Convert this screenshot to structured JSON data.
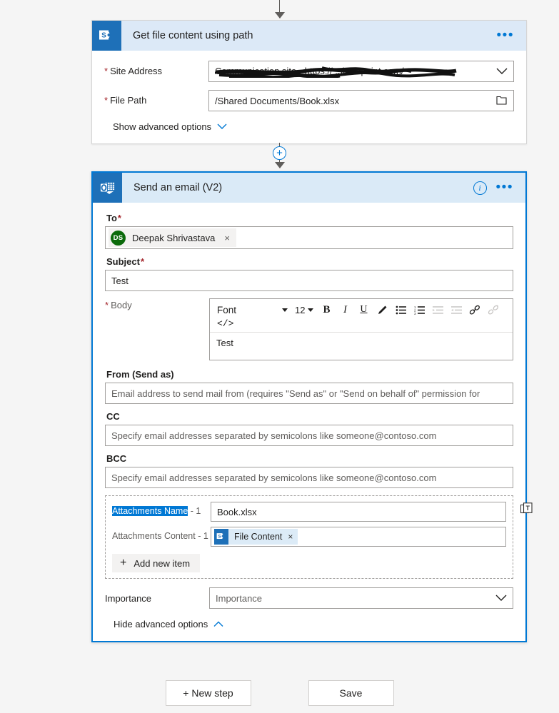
{
  "page": {
    "background": "#f5f5f5",
    "accent_blue": "#0078d4",
    "header_blue": "#dce9f7",
    "connector_brand": "#1e70b8"
  },
  "top_connector": {
    "arrow": "arrow-down-icon"
  },
  "mid_connector": {
    "plus": "+",
    "arrow": "arrow-down-icon"
  },
  "card_sharepoint": {
    "icon": "sharepoint-icon",
    "title": "Get file content using path",
    "menu": "•••",
    "fields": [
      {
        "label": "Site Address",
        "required": true,
        "required_position": "before",
        "value": "Communication site - https://       .sharepoint.com/",
        "redacted": true,
        "control": "combobox"
      },
      {
        "label": "File Path",
        "required": true,
        "required_position": "before",
        "value": "/Shared Documents/Book.xlsx",
        "redacted": false,
        "control": "file-picker"
      }
    ],
    "advanced_toggle": {
      "label": "Show advanced options",
      "chevron": "chevron-down-icon"
    }
  },
  "card_email": {
    "icon": "outlook-icon",
    "title": "Send an email (V2)",
    "info": "i",
    "menu": "•••",
    "to": {
      "label": "To",
      "required_mark": "*",
      "recipient": {
        "initials": "DS",
        "name": "Deepak Shrivastava",
        "avatar_color": "#0b6a0b",
        "remove": "×"
      }
    },
    "subject": {
      "label": "Subject",
      "required_mark": "*",
      "value": "Test"
    },
    "body": {
      "label": "Body",
      "required_mark": "*",
      "toolbar": {
        "font_name": "Font",
        "font_size": "12",
        "buttons": [
          {
            "name": "bold-icon",
            "glyph": "B",
            "disabled": false
          },
          {
            "name": "italic-icon",
            "glyph": "I",
            "disabled": false
          },
          {
            "name": "underline-icon",
            "glyph": "U",
            "disabled": false
          },
          {
            "name": "highlighter-icon",
            "glyph": "✐",
            "disabled": false
          },
          {
            "name": "bulleted-list-icon",
            "glyph": "☰",
            "disabled": false
          },
          {
            "name": "numbered-list-icon",
            "glyph": "☰",
            "disabled": false
          },
          {
            "name": "indent-increase-icon",
            "glyph": "☰",
            "disabled": true
          },
          {
            "name": "indent-decrease-icon",
            "glyph": "☰",
            "disabled": true
          },
          {
            "name": "link-icon",
            "glyph": "🔗",
            "disabled": false
          },
          {
            "name": "unlink-icon",
            "glyph": "🔗",
            "disabled": true
          }
        ],
        "code_view": "</>"
      },
      "content": "Test"
    },
    "from": {
      "label": "From (Send as)",
      "placeholder": "Email address to send mail from (requires \"Send as\" or \"Send on behalf of\" permission for"
    },
    "cc": {
      "label": "CC",
      "placeholder": "Specify email addresses separated by semicolons like someone@contoso.com"
    },
    "bcc": {
      "label": "BCC",
      "placeholder": "Specify email addresses separated by semicolons like someone@contoso.com"
    },
    "attachments": {
      "name_row": {
        "label_highlighted": "Attachments Name",
        "label_suffix": " - 1",
        "value": "Book.xlsx"
      },
      "content_row": {
        "label": "Attachments Content - 1",
        "token": {
          "icon": "sharepoint-icon",
          "text": "File Content",
          "remove": "×"
        }
      },
      "dynamic_content_icon": "insert-token-icon",
      "add_item": {
        "plus": "+",
        "label": "Add new item"
      }
    },
    "importance": {
      "label": "Importance",
      "placeholder": "Importance",
      "chevron": "chevron-down-icon"
    },
    "advanced_toggle": {
      "label": "Hide advanced options",
      "chevron": "chevron-up-icon"
    }
  },
  "footer": {
    "new_step": "+ New step",
    "save": "Save"
  }
}
